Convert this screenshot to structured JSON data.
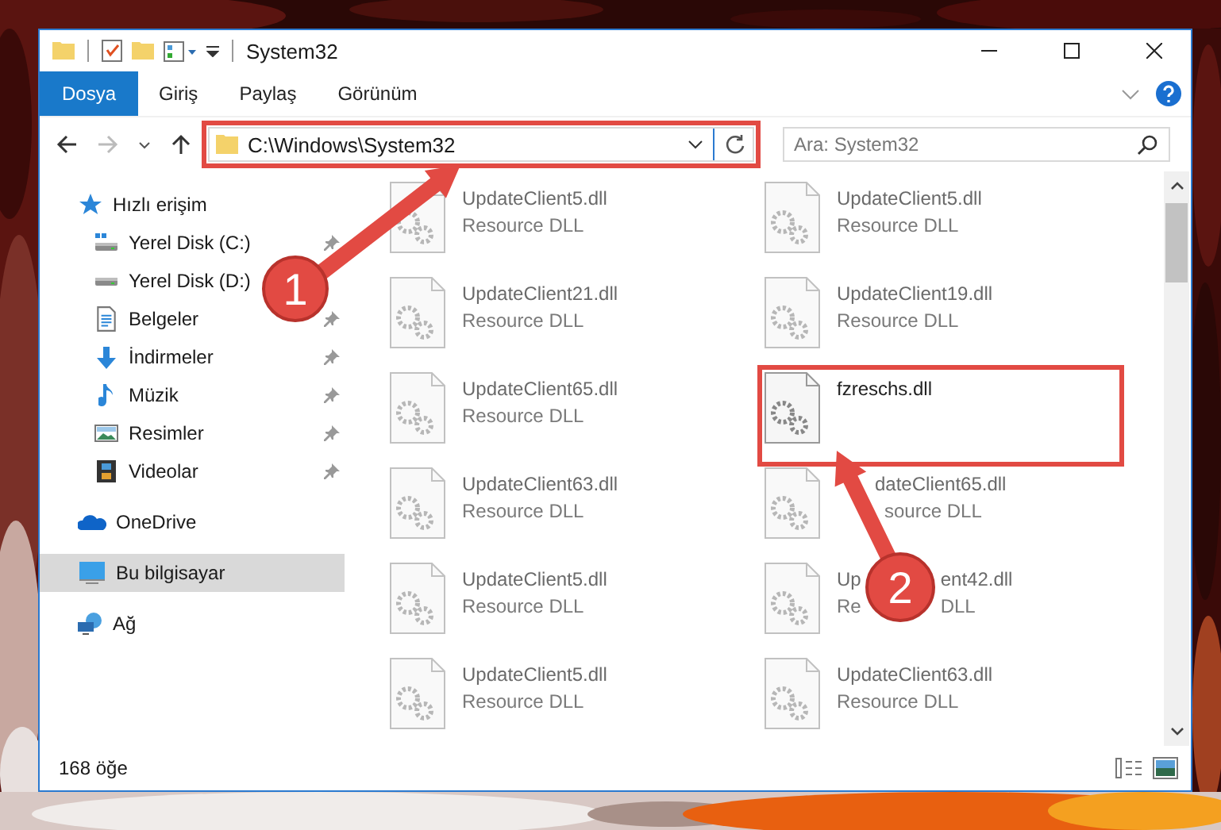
{
  "window": {
    "title": "System32"
  },
  "ribbon_tabs": [
    {
      "label": "Dosya",
      "selected": true
    },
    {
      "label": "Giriş",
      "selected": false
    },
    {
      "label": "Paylaş",
      "selected": false
    },
    {
      "label": "Görünüm",
      "selected": false
    }
  ],
  "address": {
    "value": "C:\\Windows\\System32",
    "highlighted": true
  },
  "search": {
    "placeholder": "Ara: System32"
  },
  "sidebar": {
    "items": [
      {
        "label": "Hızlı erişim",
        "kind": "quick",
        "selected": false,
        "children": [
          {
            "label": "Yerel Disk (C:)",
            "kind": "drive-c",
            "pinned": true
          },
          {
            "label": "Yerel Disk (D:)",
            "kind": "drive"
          },
          {
            "label": "Belgeler",
            "kind": "docs",
            "pinned": true
          },
          {
            "label": "İndirmeler",
            "kind": "download",
            "pinned": true
          },
          {
            "label": "Müzik",
            "kind": "music",
            "pinned": true
          },
          {
            "label": "Resimler",
            "kind": "pictures",
            "pinned": true
          },
          {
            "label": "Videolar",
            "kind": "videos",
            "pinned": true
          }
        ]
      },
      {
        "label": "OneDrive",
        "kind": "onedrive",
        "selected": false
      },
      {
        "label": "Bu bilgisayar",
        "kind": "pc",
        "selected": true
      },
      {
        "label": "Ağ",
        "kind": "network",
        "selected": false
      }
    ]
  },
  "files": [
    {
      "name_parts": [
        "UpdateClient5.dll"
      ],
      "type_parts": [
        "Resource DLL"
      ],
      "blurred": true,
      "highlighted": false
    },
    {
      "name_parts": [
        "UpdateClient5.dll"
      ],
      "type_parts": [
        "Resource DLL"
      ],
      "blurred": true,
      "highlighted": false
    },
    {
      "name_parts": [
        "UpdateClient21.dll"
      ],
      "type_parts": [
        "Resource DLL"
      ],
      "blurred": true,
      "highlighted": false
    },
    {
      "name_parts": [
        "UpdateClient19.dll"
      ],
      "type_parts": [
        "Resource DLL"
      ],
      "blurred": true,
      "highlighted": false
    },
    {
      "name_parts": [
        "UpdateClient65.dll"
      ],
      "type_parts": [
        "Resource DLL"
      ],
      "blurred": true,
      "highlighted": false
    },
    {
      "name_parts": [
        "fzreschs.dll"
      ],
      "blurred": false,
      "highlighted": true
    },
    {
      "name_parts": [
        "UpdateClient63.dll"
      ],
      "type_parts": [
        "Resource DLL"
      ],
      "blurred": true,
      "highlighted": false
    },
    {
      "name_parts": [
        "dateClient65.dll"
      ],
      "type_parts": [
        "source DLL"
      ],
      "blurred": true,
      "highlighted": false
    },
    {
      "name_parts": [
        "UpdateClient5.dll"
      ],
      "type_parts": [
        "Resource DLL"
      ],
      "blurred": true,
      "highlighted": false
    },
    {
      "name_parts": [
        "Up",
        "ent42.dll"
      ],
      "type_parts": [
        "Re",
        "DLL"
      ],
      "blurred": true,
      "highlighted": false
    },
    {
      "name_parts": [
        "UpdateClient5.dll"
      ],
      "type_parts": [
        "Resource DLL"
      ],
      "blurred": true,
      "highlighted": false
    },
    {
      "name_parts": [
        "UpdateClient63.dll"
      ],
      "type_parts": [
        "Resource DLL"
      ],
      "blurred": true,
      "highlighted": false
    }
  ],
  "callouts": [
    {
      "label": "1"
    },
    {
      "label": "2"
    }
  ],
  "status_bar": {
    "count": "168 öğe"
  }
}
